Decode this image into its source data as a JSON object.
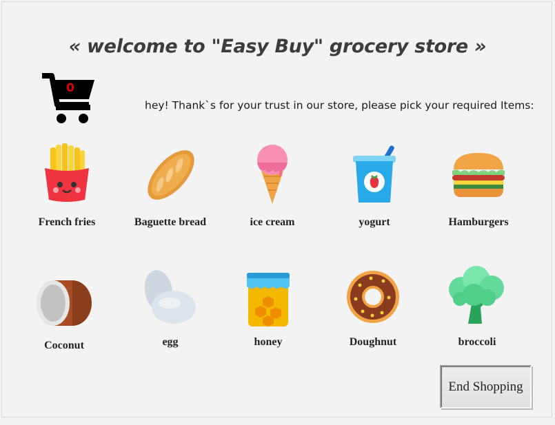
{
  "header": {
    "title": "« welcome to \"Easy Buy\" grocery store »"
  },
  "cart": {
    "icon": "shopping-cart-icon",
    "count": "0",
    "count_color": "#e00000"
  },
  "greeting": "hey! Thank`s for your trust in our store, please pick your required Items:",
  "items_row1": [
    {
      "label": "French fries",
      "icon": "french-fries-icon"
    },
    {
      "label": "Baguette bread",
      "icon": "baguette-icon"
    },
    {
      "label": "ice cream",
      "icon": "ice-cream-icon"
    },
    {
      "label": "yogurt",
      "icon": "yogurt-icon"
    },
    {
      "label": "Hamburgers",
      "icon": "hamburger-icon"
    }
  ],
  "items_row2": [
    {
      "label": "Coconut",
      "icon": "coconut-icon"
    },
    {
      "label": "egg",
      "icon": "egg-icon"
    },
    {
      "label": "honey",
      "icon": "honey-icon"
    },
    {
      "label": "Doughnut",
      "icon": "doughnut-icon"
    },
    {
      "label": "broccoli",
      "icon": "broccoli-icon"
    }
  ],
  "footer": {
    "end_button_label": "End Shopping"
  }
}
